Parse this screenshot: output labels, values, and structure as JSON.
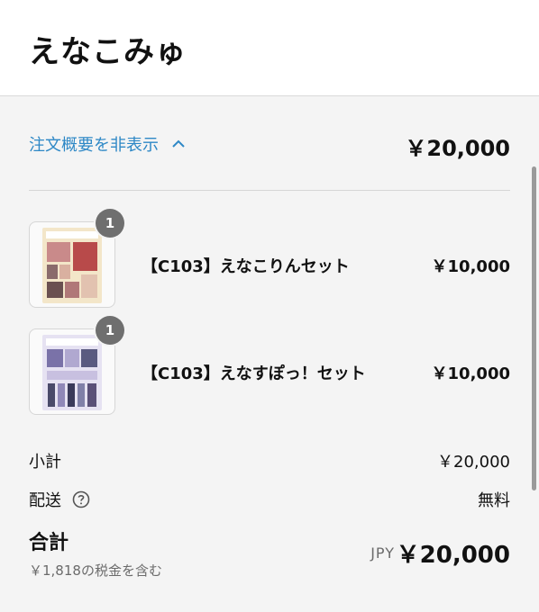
{
  "header": {
    "store_name": "えなこみゅ"
  },
  "summary": {
    "toggle_label": "注文概要を非表示",
    "total": "￥20,000"
  },
  "items": [
    {
      "name": "【C103】えなこりんセット",
      "price": "￥10,000",
      "quantity": "1"
    },
    {
      "name": "【C103】えなすぽっ！セット",
      "price": "￥10,000",
      "quantity": "1"
    }
  ],
  "subtotal": {
    "label": "小計",
    "value": "￥20,000"
  },
  "shipping": {
    "label": "配送",
    "value": "無料"
  },
  "total": {
    "label": "合計",
    "tax_note": "￥1,818の税金を含む",
    "currency": "JPY",
    "value": "￥20,000"
  },
  "colors": {
    "accent": "#2e88c6",
    "panel_bg": "#f4f4f4",
    "badge": "#6f6f6f"
  },
  "icons": {
    "toggle": "chevron-up-icon",
    "help": "help-circle-icon"
  }
}
